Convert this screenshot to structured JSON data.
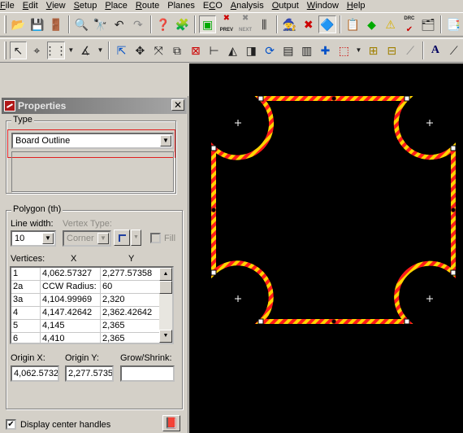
{
  "menu": [
    {
      "pre": "",
      "ul": "F",
      "post": "ile"
    },
    {
      "pre": "",
      "ul": "E",
      "post": "dit"
    },
    {
      "pre": "",
      "ul": "V",
      "post": "iew"
    },
    {
      "pre": "",
      "ul": "S",
      "post": "etup"
    },
    {
      "pre": "",
      "ul": "P",
      "post": "lace"
    },
    {
      "pre": "",
      "ul": "R",
      "post": "oute"
    },
    {
      "pre": "",
      "ul": "",
      "post": "Planes"
    },
    {
      "pre": "E",
      "ul": "C",
      "post": "O"
    },
    {
      "pre": "",
      "ul": "A",
      "post": "nalysis"
    },
    {
      "pre": "",
      "ul": "O",
      "post": "utput"
    },
    {
      "pre": "",
      "ul": "W",
      "post": "indow"
    },
    {
      "pre": "",
      "ul": "H",
      "post": "elp"
    }
  ],
  "toolbar1": {
    "prev_label": "PREV",
    "next_label": "NEXT",
    "drc_label": "DRC"
  },
  "panel": {
    "title": "Properties",
    "type_group": "Type",
    "type_value": "Board Outline",
    "polygon_group": "Polygon (th)",
    "line_width_label": "Line width:",
    "line_width_value": "10",
    "vertex_type_label": "Vertex Type:",
    "vertex_type_value": "Corner",
    "fill_label": "Fill",
    "vertices_label": "Vertices:",
    "col_x": "X",
    "col_y": "Y",
    "rows": [
      {
        "id": "1",
        "x": "4,062.57327",
        "y": "2,277.57358"
      },
      {
        "id": "2a",
        "x": "CCW Radius:",
        "y": "60"
      },
      {
        "id": "3a",
        "x": "4,104.99969",
        "y": "2,320"
      },
      {
        "id": "4",
        "x": "4,147.42642",
        "y": "2,362.42642"
      },
      {
        "id": "5",
        "x": "4,145",
        "y": "2,365"
      },
      {
        "id": "6",
        "x": "4,410",
        "y": "2,365"
      }
    ],
    "origin_x_label": "Origin X:",
    "origin_x_value": "4,062.5732",
    "origin_y_label": "Origin Y:",
    "origin_y_value": "2,277.5735",
    "grow_label": "Grow/Shrink:",
    "grow_value": "",
    "display_handles_label": "Display center handles",
    "display_handles_checked": true
  },
  "colors": {
    "outline_a": "#ff1a1a",
    "outline_b": "#ffd400",
    "canvas": "#000000",
    "highlight_box": "#e02020"
  }
}
